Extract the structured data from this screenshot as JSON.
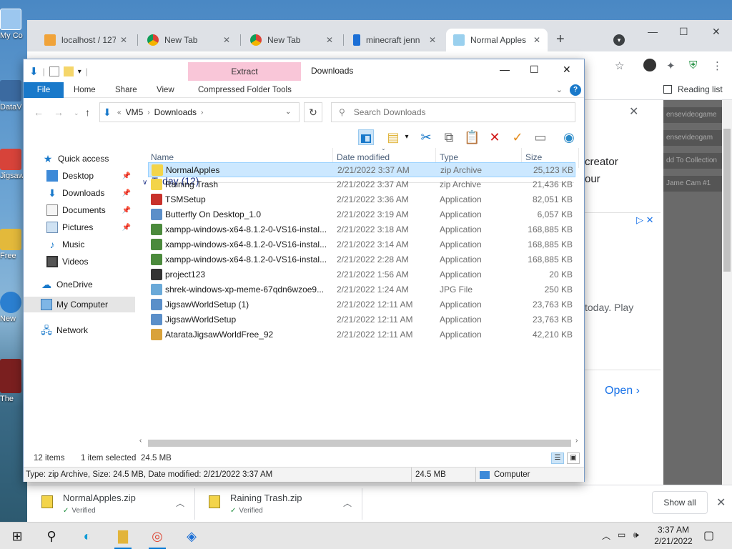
{
  "colors": {
    "accent": "#1979ca",
    "extract_tab": "#f9c6d8",
    "selection": "#cce8ff"
  },
  "desktop": {
    "icons": [
      {
        "label": "My Co",
        "icon": "computer-icon"
      },
      {
        "label": "DataV",
        "icon": "shortcut-icon"
      },
      {
        "label": "Jigsaw",
        "icon": "puzzle-icon"
      },
      {
        "label": "Free",
        "icon": "puzzle-icon"
      },
      {
        "label": "New",
        "icon": "globe-icon"
      },
      {
        "label": "The",
        "icon": "game-icon"
      }
    ]
  },
  "chrome": {
    "tabs": [
      {
        "label": "localhost / 127.",
        "icon": "phpmyadmin-icon"
      },
      {
        "label": "New Tab",
        "icon": "chrome-icon"
      },
      {
        "label": "New Tab",
        "icon": "chrome-icon"
      },
      {
        "label": "minecraft jenn",
        "icon": "bing-icon"
      },
      {
        "label": "Normal Apples",
        "icon": "page-icon"
      }
    ],
    "new_tab": "+",
    "reading_list": "Reading list",
    "page": {
      "ad_line1": "creator",
      "ad_line2": "our",
      "ad_line3": "today. Play",
      "open_label": "Open",
      "side_items": [
        "ensevideogame",
        "ensevideogam",
        "dd To Collection",
        "Jame Cam #1"
      ]
    },
    "downloads": [
      {
        "name": "NormalApples.zip",
        "status": "Verified"
      },
      {
        "name": "Raining Trash.zip",
        "status": "Verified"
      }
    ],
    "show_all": "Show all"
  },
  "explorer": {
    "caption": "Downloads",
    "extract_tab": "Extract",
    "ribbon_tabs": [
      "File",
      "Home",
      "Share",
      "View"
    ],
    "tool_tab": "Compressed Folder Tools",
    "address": [
      "VM5",
      "Downloads"
    ],
    "address_prefix": "«",
    "search_placeholder": "Search Downloads",
    "nav": [
      {
        "label": "Quick access",
        "icon": "star-icon",
        "pinned": false
      },
      {
        "label": "Desktop",
        "icon": "desktop-icon",
        "pinned": true
      },
      {
        "label": "Downloads",
        "icon": "download-icon",
        "pinned": true
      },
      {
        "label": "Documents",
        "icon": "documents-icon",
        "pinned": true
      },
      {
        "label": "Pictures",
        "icon": "pictures-icon",
        "pinned": true
      },
      {
        "label": "Music",
        "icon": "music-icon",
        "pinned": false
      },
      {
        "label": "Videos",
        "icon": "videos-icon",
        "pinned": false
      },
      {
        "label": "OneDrive",
        "icon": "cloud-icon",
        "pinned": false
      },
      {
        "label": "My Computer",
        "icon": "computer-icon",
        "pinned": false
      },
      {
        "label": "Network",
        "icon": "network-icon",
        "pinned": false
      }
    ],
    "columns": [
      "Name",
      "Date modified",
      "Type",
      "Size"
    ],
    "group": "Today (12)",
    "files": [
      {
        "name": "NormalApples",
        "date": "2/21/2022 3:37 AM",
        "type": "zip Archive",
        "size": "25,123 KB",
        "icon": "zip-icon"
      },
      {
        "name": "Raining Trash",
        "date": "2/21/2022 3:37 AM",
        "type": "zip Archive",
        "size": "21,436 KB",
        "icon": "zip-icon"
      },
      {
        "name": "TSMSetup",
        "date": "2/21/2022 3:36 AM",
        "type": "Application",
        "size": "82,051 KB",
        "icon": "setup-icon"
      },
      {
        "name": "Butterfly On Desktop_1.0",
        "date": "2/21/2022 3:19 AM",
        "type": "Application",
        "size": "6,057 KB",
        "icon": "installer-icon"
      },
      {
        "name": "xampp-windows-x64-8.1.2-0-VS16-instal...",
        "date": "2/21/2022 3:18 AM",
        "type": "Application",
        "size": "168,885 KB",
        "icon": "xampp-icon"
      },
      {
        "name": "xampp-windows-x64-8.1.2-0-VS16-instal...",
        "date": "2/21/2022 3:14 AM",
        "type": "Application",
        "size": "168,885 KB",
        "icon": "xampp-icon"
      },
      {
        "name": "xampp-windows-x64-8.1.2-0-VS16-instal...",
        "date": "2/21/2022 2:28 AM",
        "type": "Application",
        "size": "168,885 KB",
        "icon": "xampp-icon"
      },
      {
        "name": "project123",
        "date": "2/21/2022 1:56 AM",
        "type": "Application",
        "size": "20 KB",
        "icon": "app-icon"
      },
      {
        "name": "shrek-windows-xp-meme-67qdn6wzoe9...",
        "date": "2/21/2022 1:24 AM",
        "type": "JPG File",
        "size": "250 KB",
        "icon": "image-icon"
      },
      {
        "name": "JigsawWorldSetup (1)",
        "date": "2/21/2022 12:11 AM",
        "type": "Application",
        "size": "23,763 KB",
        "icon": "installer-icon"
      },
      {
        "name": "JigsawWorldSetup",
        "date": "2/21/2022 12:11 AM",
        "type": "Application",
        "size": "23,763 KB",
        "icon": "installer-icon"
      },
      {
        "name": "AtarataJigsawWorldFree_92",
        "date": "2/21/2022 12:11 AM",
        "type": "Application",
        "size": "42,210 KB",
        "icon": "puzzle-icon"
      }
    ],
    "status": {
      "items": "12 items",
      "selected": "1 item selected",
      "selected_size": "24.5 MB",
      "details": "Type: zip Archive, Size: 24.5 MB, Date modified: 2/21/2022 3:37 AM",
      "size": "24.5 MB",
      "location": "Computer"
    }
  },
  "taskbar": {
    "time": "3:37 AM",
    "date": "2/21/2022"
  }
}
